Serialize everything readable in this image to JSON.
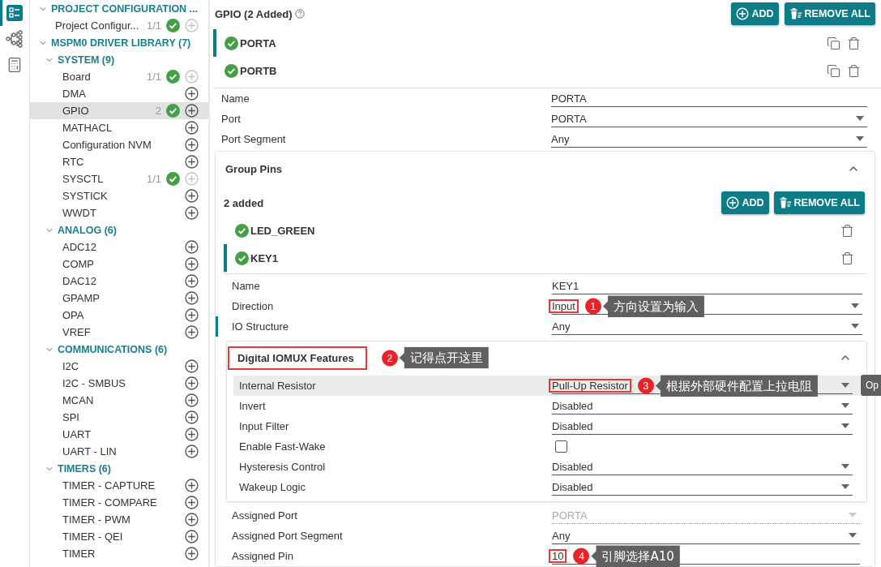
{
  "rail": [
    {
      "kind": "list",
      "selected": true
    },
    {
      "kind": "diagram",
      "selected": false
    },
    {
      "kind": "calculator",
      "selected": false
    }
  ],
  "sidebar": [
    {
      "kind": "group",
      "label": "PROJECT CONFIGURATION ...",
      "expanded": true,
      "children": [
        {
          "kind": "module",
          "label": "Project Configur...",
          "count": "1/1",
          "configured": true,
          "can_add": false,
          "selected": false
        }
      ]
    },
    {
      "kind": "group",
      "label": "MSPM0 DRIVER LIBRARY (7)",
      "expanded": true,
      "children": [
        {
          "kind": "group",
          "label": "SYSTEM (9)",
          "expanded": true,
          "children": [
            {
              "kind": "module",
              "label": "Board",
              "count": "1/1",
              "configured": true,
              "can_add": false,
              "selected": false
            },
            {
              "kind": "module",
              "label": "DMA",
              "configured": false,
              "can_add": true,
              "selected": false
            },
            {
              "kind": "module",
              "label": "GPIO",
              "count": "2",
              "configured": true,
              "can_add": true,
              "selected": true
            },
            {
              "kind": "module",
              "label": "MATHACL",
              "configured": false,
              "can_add": true,
              "selected": false
            },
            {
              "kind": "module",
              "label": "Configuration NVM",
              "configured": false,
              "can_add": true,
              "selected": false
            },
            {
              "kind": "module",
              "label": "RTC",
              "configured": false,
              "can_add": true,
              "selected": false
            },
            {
              "kind": "module",
              "label": "SYSCTL",
              "count": "1/1",
              "configured": true,
              "can_add": false,
              "selected": false
            },
            {
              "kind": "module",
              "label": "SYSTICK",
              "configured": false,
              "can_add": true,
              "selected": false
            },
            {
              "kind": "module",
              "label": "WWDT",
              "configured": false,
              "can_add": true,
              "selected": false
            }
          ]
        },
        {
          "kind": "group",
          "label": "ANALOG (6)",
          "expanded": true,
          "children": [
            {
              "kind": "module",
              "label": "ADC12",
              "configured": false,
              "can_add": true,
              "selected": false
            },
            {
              "kind": "module",
              "label": "COMP",
              "configured": false,
              "can_add": true,
              "selected": false
            },
            {
              "kind": "module",
              "label": "DAC12",
              "configured": false,
              "can_add": true,
              "selected": false
            },
            {
              "kind": "module",
              "label": "GPAMP",
              "configured": false,
              "can_add": true,
              "selected": false
            },
            {
              "kind": "module",
              "label": "OPA",
              "configured": false,
              "can_add": true,
              "selected": false
            },
            {
              "kind": "module",
              "label": "VREF",
              "configured": false,
              "can_add": true,
              "selected": false
            }
          ]
        },
        {
          "kind": "group",
          "label": "COMMUNICATIONS (6)",
          "expanded": true,
          "children": [
            {
              "kind": "module",
              "label": "I2C",
              "configured": false,
              "can_add": true,
              "selected": false
            },
            {
              "kind": "module",
              "label": "I2C - SMBUS",
              "configured": false,
              "can_add": true,
              "selected": false
            },
            {
              "kind": "module",
              "label": "MCAN",
              "configured": false,
              "can_add": true,
              "selected": false
            },
            {
              "kind": "module",
              "label": "SPI",
              "configured": false,
              "can_add": true,
              "selected": false
            },
            {
              "kind": "module",
              "label": "UART",
              "configured": false,
              "can_add": true,
              "selected": false
            },
            {
              "kind": "module",
              "label": "UART - LIN",
              "configured": false,
              "can_add": true,
              "selected": false
            }
          ]
        },
        {
          "kind": "group",
          "label": "TIMERS (6)",
          "expanded": true,
          "children": [
            {
              "kind": "module",
              "label": "TIMER - CAPTURE",
              "configured": false,
              "can_add": true,
              "selected": false
            },
            {
              "kind": "module",
              "label": "TIMER - COMPARE",
              "configured": false,
              "can_add": true,
              "selected": false
            },
            {
              "kind": "module",
              "label": "TIMER - PWM",
              "configured": false,
              "can_add": true,
              "selected": false
            },
            {
              "kind": "module",
              "label": "TIMER - QEI",
              "configured": false,
              "can_add": true,
              "selected": false
            },
            {
              "kind": "module",
              "label": "TIMER",
              "configured": false,
              "can_add": true,
              "selected": false
            }
          ]
        }
      ]
    }
  ],
  "main": {
    "title": "GPIO (2 Added)",
    "buttons": [
      {
        "kind": "add",
        "label": "ADD"
      },
      {
        "kind": "remove",
        "label": "REMOVE ALL"
      }
    ],
    "instances": [
      {
        "label": "PORTA",
        "selected": true,
        "configured": true,
        "copyable": true
      },
      {
        "label": "PORTB",
        "selected": false,
        "configured": true,
        "copyable": true
      }
    ],
    "fields": [
      {
        "kind": "text",
        "label": "Name",
        "value": "PORTA",
        "disabled": false,
        "marked": false
      },
      {
        "kind": "select",
        "label": "Port",
        "value": "PORTA",
        "disabled": false,
        "marked": false
      },
      {
        "kind": "select",
        "label": "Port Segment",
        "value": "Any",
        "disabled": false,
        "marked": false
      }
    ],
    "group_pins": {
      "title": "Group Pins",
      "expanded": true,
      "count_label": "2 added",
      "buttons": [
        {
          "kind": "add",
          "label": "ADD"
        },
        {
          "kind": "remove",
          "label": "REMOVE ALL"
        }
      ],
      "pins": [
        {
          "label": "LED_GREEN",
          "selected": false,
          "configured": true,
          "copyable": false
        },
        {
          "label": "KEY1",
          "selected": true,
          "configured": true,
          "copyable": false
        }
      ],
      "fields": [
        {
          "kind": "text",
          "label": "Name",
          "value": "KEY1",
          "disabled": false,
          "marked": false
        },
        {
          "kind": "select",
          "label": "Direction",
          "value": "Input",
          "disabled": false,
          "marked": false,
          "annotation": {
            "number": "1",
            "text": "方向设置为输入"
          }
        },
        {
          "kind": "select",
          "label": "IO Structure",
          "value": "Any",
          "disabled": false,
          "marked": true
        }
      ],
      "subpanel": {
        "title": "Digital IOMUX Features",
        "expanded": true,
        "annotation": {
          "number": "2",
          "text": "记得点开这里"
        },
        "fields": [
          {
            "kind": "select",
            "label": "Internal Resistor",
            "value": "Pull-Up Resistor",
            "disabled": false,
            "marked": false,
            "highlighted": true,
            "annotation": {
              "number": "3",
              "text": "根据外部硬件配置上拉电阻"
            }
          },
          {
            "kind": "select",
            "label": "Invert",
            "value": "Disabled",
            "disabled": false,
            "marked": false,
            "highlighted": false
          },
          {
            "kind": "select",
            "label": "Input Filter",
            "value": "Disabled",
            "disabled": false,
            "marked": false,
            "highlighted": false
          },
          {
            "kind": "checkbox",
            "label": "Enable Fast-Wake",
            "checked": false,
            "disabled": false,
            "marked": false,
            "highlighted": false
          },
          {
            "kind": "select",
            "label": "Hysteresis Control",
            "value": "Disabled",
            "disabled": false,
            "marked": false,
            "highlighted": false
          },
          {
            "kind": "select",
            "label": "Wakeup Logic",
            "value": "Disabled",
            "disabled": false,
            "marked": false,
            "highlighted": false
          }
        ]
      },
      "fields_after": [
        {
          "kind": "select",
          "label": "Assigned Port",
          "value": "PORTA",
          "disabled": true,
          "marked": false
        },
        {
          "kind": "select",
          "label": "Assigned Port Segment",
          "value": "Any",
          "disabled": false,
          "marked": false
        },
        {
          "kind": "text",
          "label": "Assigned Pin",
          "value": "10",
          "disabled": false,
          "marked": false,
          "annotation": {
            "number": "4",
            "text": "引脚选择A10"
          }
        }
      ]
    },
    "edge_tooltip": "Op"
  }
}
